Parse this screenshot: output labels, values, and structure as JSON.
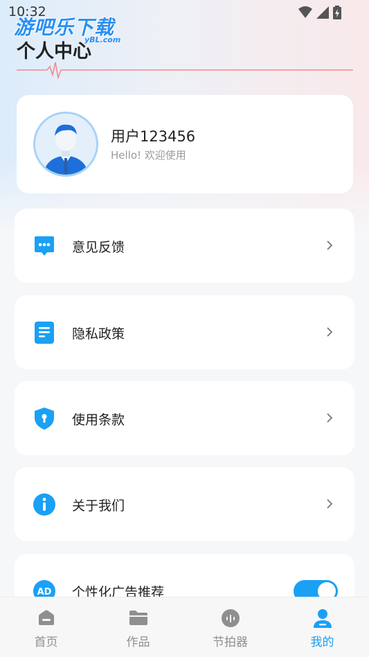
{
  "status": {
    "time": "10:32"
  },
  "watermark": {
    "brand": "游吧乐下载",
    "domain": "yBL.com"
  },
  "header": {
    "title": "个人中心"
  },
  "profile": {
    "username": "用户123456",
    "greeting": "Hello! 欢迎使用"
  },
  "menu": [
    {
      "label": "意见反馈",
      "icon": "chat-bubble-icon"
    },
    {
      "label": "隐私政策",
      "icon": "document-icon"
    },
    {
      "label": "使用条款",
      "icon": "shield-lock-icon"
    },
    {
      "label": "关于我们",
      "icon": "info-icon"
    }
  ],
  "ad_setting": {
    "label": "个性化广告推荐",
    "icon_text": "AD",
    "enabled": true
  },
  "tabbar": {
    "items": [
      {
        "label": "首页",
        "icon": "home-icon"
      },
      {
        "label": "作品",
        "icon": "folder-icon"
      },
      {
        "label": "节拍器",
        "icon": "metronome-icon"
      },
      {
        "label": "我的",
        "icon": "user-icon"
      }
    ],
    "active": "我的"
  },
  "colors": {
    "accent": "#1aa0f5",
    "pulse": "#f08a8a"
  }
}
